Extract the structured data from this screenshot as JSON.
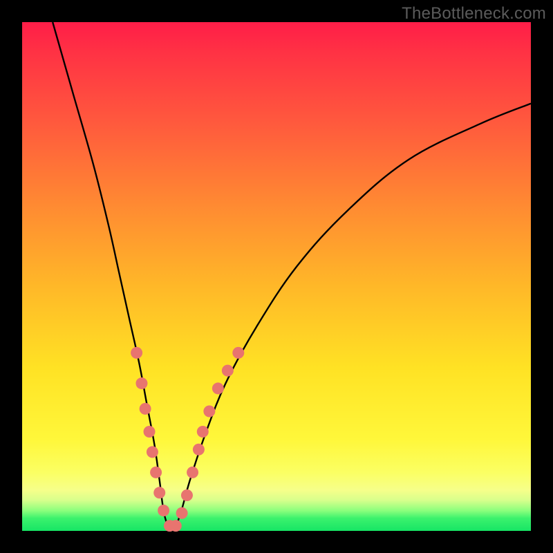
{
  "watermark": {
    "text": "TheBottleneck.com"
  },
  "colors": {
    "curve_stroke": "#000000",
    "dot_fill": "#e8746f",
    "dot_stroke": "#c95a55",
    "frame": "#000000"
  },
  "chart_data": {
    "type": "line",
    "title": "",
    "xlabel": "",
    "ylabel": "",
    "xlim": [
      0,
      100
    ],
    "ylim": [
      0,
      100
    ],
    "grid": false,
    "legend": false,
    "note": "V-shaped bottleneck mismatch curve. Axes unlabeled; x is relative component strength (arbitrary 0-100), y is bottleneck severity % (0 at bottom = no bottleneck, 100 at top = severe). Values estimated from pixel positions.",
    "series": [
      {
        "name": "bottleneck-curve",
        "x": [
          6,
          10,
          14,
          17,
          19,
          21,
          23,
          24.5,
          26,
          27,
          28,
          29.5,
          31,
          33,
          36,
          40,
          46,
          54,
          64,
          76,
          90,
          100
        ],
        "y": [
          100,
          86,
          72,
          60,
          51,
          42,
          33,
          25,
          17,
          10,
          3,
          0,
          3,
          10,
          19,
          29,
          40,
          52,
          63,
          73,
          80,
          84
        ]
      }
    ],
    "markers": {
      "name": "sample-dots",
      "note": "Pink dots clustered around the curve minimum; coordinates in same 0-100 space, estimated.",
      "points": [
        {
          "x": 22.5,
          "y": 35
        },
        {
          "x": 23.5,
          "y": 29
        },
        {
          "x": 24.2,
          "y": 24
        },
        {
          "x": 25.0,
          "y": 19.5
        },
        {
          "x": 25.6,
          "y": 15.5
        },
        {
          "x": 26.3,
          "y": 11.5
        },
        {
          "x": 27.0,
          "y": 7.5
        },
        {
          "x": 27.8,
          "y": 4.0
        },
        {
          "x": 29.0,
          "y": 1.0
        },
        {
          "x": 30.2,
          "y": 1.0
        },
        {
          "x": 31.4,
          "y": 3.5
        },
        {
          "x": 32.4,
          "y": 7.0
        },
        {
          "x": 33.5,
          "y": 11.5
        },
        {
          "x": 34.7,
          "y": 16.0
        },
        {
          "x": 35.5,
          "y": 19.5
        },
        {
          "x": 36.8,
          "y": 23.5
        },
        {
          "x": 38.5,
          "y": 28.0
        },
        {
          "x": 40.4,
          "y": 31.5
        },
        {
          "x": 42.5,
          "y": 35.0
        }
      ]
    }
  }
}
